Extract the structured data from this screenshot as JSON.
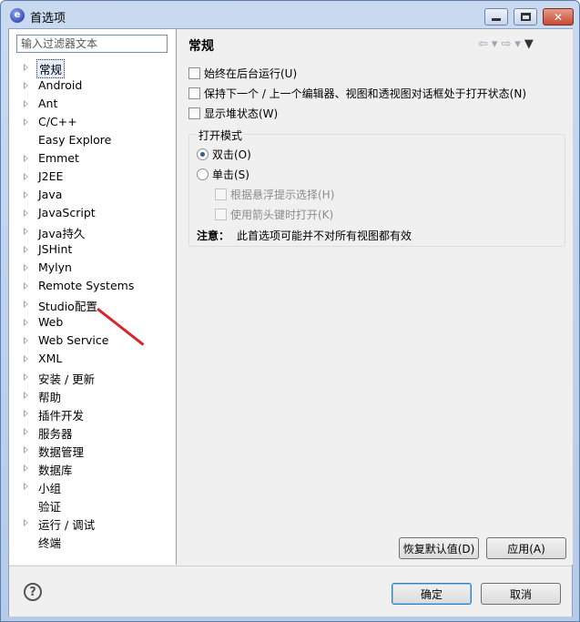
{
  "window": {
    "title": "首选项"
  },
  "filter": {
    "placeholder": "输入过滤器文本"
  },
  "tree": [
    {
      "label": "常规",
      "expandable": true,
      "selected": true
    },
    {
      "label": "Android",
      "expandable": true
    },
    {
      "label": "Ant",
      "expandable": true
    },
    {
      "label": "C/C++",
      "expandable": true
    },
    {
      "label": "Easy Explore",
      "expandable": false
    },
    {
      "label": "Emmet",
      "expandable": true
    },
    {
      "label": "J2EE",
      "expandable": true
    },
    {
      "label": "Java",
      "expandable": true
    },
    {
      "label": "JavaScript",
      "expandable": true
    },
    {
      "label": "Java持久",
      "expandable": true
    },
    {
      "label": "JSHint",
      "expandable": true
    },
    {
      "label": "Mylyn",
      "expandable": true
    },
    {
      "label": "Remote Systems",
      "expandable": true
    },
    {
      "label": "Studio配置",
      "expandable": true
    },
    {
      "label": "Web",
      "expandable": true
    },
    {
      "label": "Web Service",
      "expandable": true
    },
    {
      "label": "XML",
      "expandable": true
    },
    {
      "label": "安装 / 更新",
      "expandable": true
    },
    {
      "label": "帮助",
      "expandable": true
    },
    {
      "label": "插件开发",
      "expandable": true
    },
    {
      "label": "服务器",
      "expandable": true
    },
    {
      "label": "数据管理",
      "expandable": true
    },
    {
      "label": "数据库",
      "expandable": true
    },
    {
      "label": "小组",
      "expandable": true
    },
    {
      "label": "验证",
      "expandable": false
    },
    {
      "label": "运行 / 调试",
      "expandable": true
    },
    {
      "label": "终端",
      "expandable": false
    }
  ],
  "page": {
    "title": "常规",
    "options": [
      {
        "label": "始终在后台运行(U)",
        "checked": false
      },
      {
        "label": "保持下一个 / 上一个编辑器、视图和透视图对话框处于打开状态(N)",
        "checked": false
      },
      {
        "label": "显示堆状态(W)",
        "checked": false
      }
    ],
    "open_mode": {
      "title": "打开模式",
      "double_click": "双击(O)",
      "single_click": "单击(S)",
      "hover_select": "根据悬浮提示选择(H)",
      "arrow_open": "使用箭头键时打开(K)",
      "note_label": "注意：",
      "note_text": "此首选项可能并不对所有视图都有效"
    },
    "restore_defaults": "恢复默认值(D)",
    "apply": "应用(A)"
  },
  "footer": {
    "ok": "确定",
    "cancel": "取消"
  }
}
